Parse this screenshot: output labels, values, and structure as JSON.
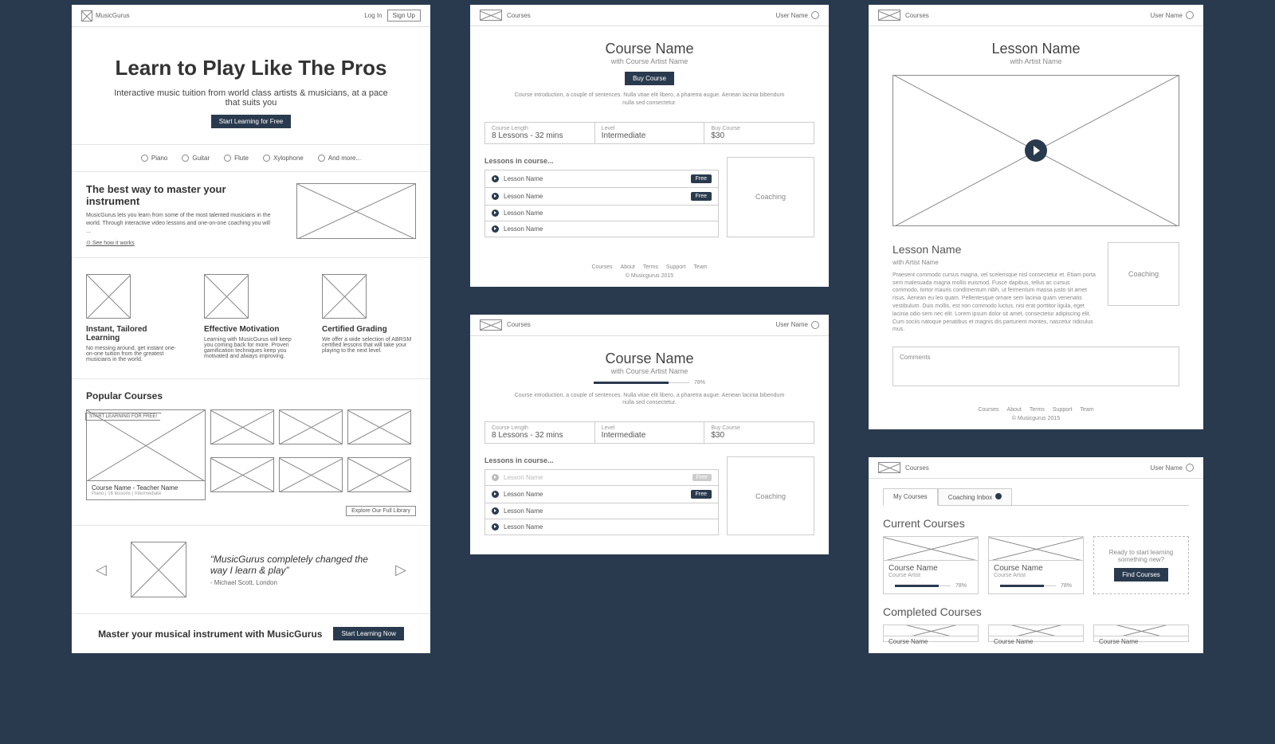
{
  "brand": "MusicGurus",
  "nav": {
    "login": "Log In",
    "signup": "Sign Up",
    "courses": "Courses",
    "userName": "User Name"
  },
  "home": {
    "hero_title": "Learn to Play Like The Pros",
    "hero_sub": "Interactive music tuition from world class artists & musicians, at a pace that suits you",
    "hero_cta": "Start Learning for Free",
    "instruments": [
      "Piano",
      "Guitar",
      "Flute",
      "Xylophone",
      "And more..."
    ],
    "intro_h": "The best way to master your instrument",
    "intro_p": "MusicGurus lets you learn from some of the most talented musicians in the world. Through interactive video lessons and one-on-one coaching you will ...",
    "intro_link": "See how it works",
    "features": [
      {
        "h": "Instant, Tailored Learning",
        "p": "No messing around, get instant one-on-one tuition from the greatest musicians in the world."
      },
      {
        "h": "Effective Motivation",
        "p": "Learning with MusicGurus will keep you coming back for more. Proven gamification techniques keep you motivated and always improving."
      },
      {
        "h": "Certified Grading",
        "p": "We offer a wide selection of ABRSM certified lessons that will take your playing to the next level."
      }
    ],
    "popular_h": "Popular Courses",
    "pop_tag": "START LEARNING FOR FREE!",
    "pop_name": "Course Name - Teacher Name",
    "pop_meta": "Piano | 16 lessons | Intermediate",
    "explore": "Explore Our Full Library",
    "quote_text": "“MusicGurus completely changed the way I learn & play”",
    "quote_cite": "- Michael Scott, London",
    "cta_text": "Master your musical instrument with MusicGurus",
    "cta_btn": "Start Learning Now"
  },
  "course": {
    "title": "Course Name",
    "artist": "with Course Artist Name",
    "buy_btn": "Buy Course",
    "desc": "Course introduction, a couple of sentences. Nulla vitae elit libero, a pharetra augue. Aenean lacinia bibendum nulla sed consectetur.",
    "stats": [
      {
        "l": "Course Length",
        "v": "8 Lessons - 32 mins"
      },
      {
        "l": "Level",
        "v": "Intermediate"
      },
      {
        "l": "Buy Course",
        "v": "$30"
      }
    ],
    "lessons_h": "Lessons in course...",
    "lesson_label": "Lesson Name",
    "free_tag": "Free",
    "coaching": "Coaching",
    "progress_pct": "78%"
  },
  "footer": {
    "links": [
      "Courses",
      "About",
      "Terms",
      "Support",
      "Team"
    ],
    "copy": "© Musicgurus 2015"
  },
  "lesson": {
    "h": "Lesson Name",
    "artist": "with Artist Name",
    "body_h": "Lesson Name",
    "body_artist": "with Artist Name",
    "body_p": "Praesent commodo cursus magna, vel scelerisque nisl consectetur et. Etiam porta sem malesuada magna mollis euismod. Fusce dapibus, tellus ac cursus commodo, tortor mauris condimentum nibh, ut fermentum massa justo sit amet risus. Aenean eu leo quam. Pellentesque ornare sem lacinia quam venenatis vestibulum. Duis mollis, est non commodo luctus, nisi erat porttitor ligula, eget lacinia odio sem nec elit. Lorem ipsum dolor sit amet, consectetur adipiscing elit. Cum sociis natoque penatibus et magnis dis parturient montes, nascetur ridiculus mus.",
    "comments": "Comments"
  },
  "dash": {
    "tab_my": "My Courses",
    "tab_inbox": "Coaching Inbox",
    "current_h": "Current Courses",
    "completed_h": "Completed Courses",
    "card_name": "Course Name",
    "card_artist": "Course Artist",
    "card_pct": "78%",
    "promo_text": "Ready to start learning something new?",
    "promo_btn": "Find Courses"
  }
}
